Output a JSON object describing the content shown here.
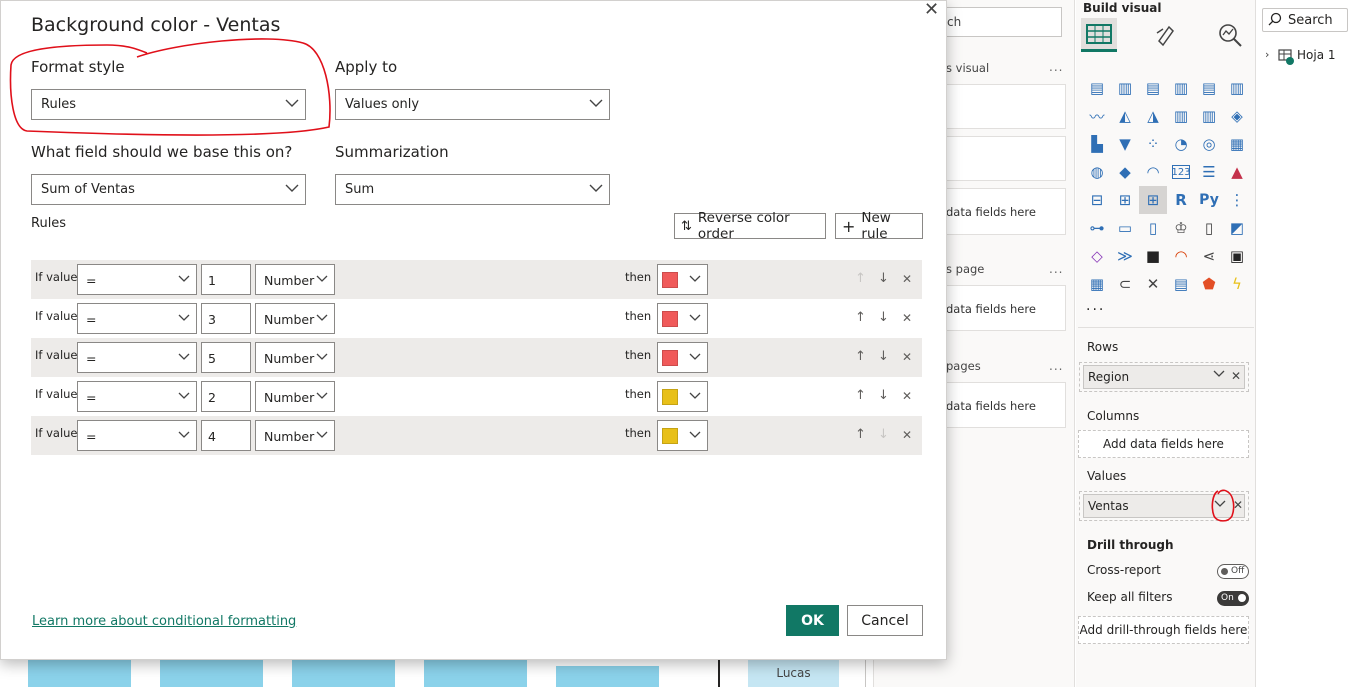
{
  "dialog": {
    "title": "Background color - Ventas",
    "format_style_label": "Format style",
    "format_style_value": "Rules",
    "apply_to_label": "Apply to",
    "apply_to_value": "Values only",
    "field_label": "What field should we base this on?",
    "field_value": "Sum of Ventas",
    "summarization_label": "Summarization",
    "summarization_value": "Sum",
    "rules_label": "Rules",
    "reverse_label": "Reverse color order",
    "new_rule_label": "New rule",
    "learn_more": "Learn more about conditional formatting",
    "ok": "OK",
    "cancel": "Cancel",
    "rules": [
      {
        "if": "If value",
        "op": "=",
        "value": "1",
        "type": "Number",
        "then": "then",
        "color": "#f05a5a"
      },
      {
        "if": "If value",
        "op": "=",
        "value": "3",
        "type": "Number",
        "then": "then",
        "color": "#f05a5a"
      },
      {
        "if": "If value",
        "op": "=",
        "value": "5",
        "type": "Number",
        "then": "then",
        "color": "#f05a5a"
      },
      {
        "if": "If value",
        "op": "=",
        "value": "2",
        "type": "Number",
        "then": "then",
        "color": "#e8c018"
      },
      {
        "if": "If value",
        "op": "=",
        "value": "4",
        "type": "Number",
        "then": "then",
        "color": "#e8c018"
      }
    ],
    "annotation_color": "#e0101a"
  },
  "canvas": {
    "partial_name": "Lucas",
    "bar_color": "#8bd2ea"
  },
  "filters": {
    "search_partial": "ch",
    "section1": "s visual",
    "section2": "s page",
    "section3": "pages",
    "add_fields": "data fields here",
    "dots": "..."
  },
  "viz": {
    "title": "Build visual",
    "more": "...",
    "rows_label": "Rows",
    "rows_field": "Region",
    "columns_label": "Columns",
    "columns_placeholder": "Add data fields here",
    "values_label": "Values",
    "values_field": "Ventas",
    "drill_label": "Drill through",
    "cross_report": "Cross-report",
    "cross_report_state": "Off",
    "keep_filters": "Keep all filters",
    "keep_filters_state": "On",
    "drill_placeholder": "Add drill-through fields here",
    "accent": "#117865"
  },
  "data_pane": {
    "search_placeholder": "Search",
    "table_name": "Hoja 1"
  }
}
